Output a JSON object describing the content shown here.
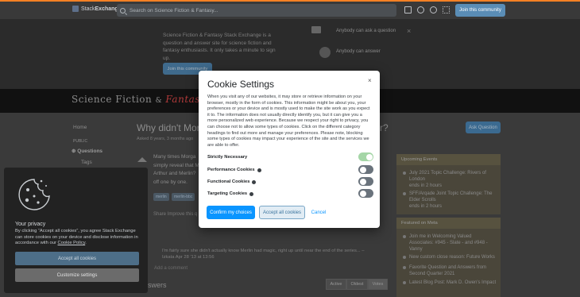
{
  "topbar": {
    "brand_prefix": "Stack",
    "brand_suffix": "Exchange",
    "search_placeholder": "Search on Science Fiction & Fantasy...",
    "join_label": "Join this community",
    "icons": [
      "inbox-icon",
      "achievements-icon",
      "help-icon",
      "site-switcher-icon"
    ]
  },
  "hero": {
    "description": "Science Fiction & Fantasy Stack Exchange is a question and answer site for science fiction and fantasy enthusiasts. It only takes a minute to sign up.",
    "join_label": "Join this community",
    "items": [
      "Anybody can ask a question",
      "Anybody can answer"
    ]
  },
  "banner": {
    "title_plain": "Science Fiction",
    "amp": "&",
    "title_accent": "Fantasy"
  },
  "left_nav": {
    "home": "Home",
    "public": "PUBLIC",
    "questions": "Questions",
    "tags": "Tags"
  },
  "question": {
    "title_start": "Why didn't Mor",
    "title_end": "r?",
    "meta": "Asked 8 years, 3 months ago",
    "body_lines": [
      "Many times Morga",
      "simply reveal that M",
      "Arthur and Merlin?",
      "off one by one."
    ],
    "tags": [
      "merlin",
      "merlin-bbc"
    ],
    "share": "Share  Improve this q",
    "comment_line1": "I'm fairly sure she didn't actually know Merlin had magic, right up until near the end of the series... –",
    "comment_line2": "Izkata  Apr 28 '13 at 13:56",
    "add_comment": "Add a comment",
    "answers_heading": "swers",
    "sort_options": [
      "Active",
      "Oldest",
      "Votes"
    ],
    "ask_button": "Ask Question"
  },
  "sidebar": {
    "upcoming_title": "Upcoming Events",
    "upcoming_items": [
      {
        "title": "July 2021 Topic Challenge: Rivers of London",
        "note": "ends in 2 hours"
      },
      {
        "title": "SFF/Arqade Joint Topic Challenge: The Elder Scrolls",
        "note": "ends in 2 hours"
      }
    ],
    "meta_title": "Featured on Meta",
    "meta_items": [
      "Join me in Welcoming Valued Associates: #945 - Slate - and #948 - Vanny",
      "New custom close reason: Future Works",
      "Favorite Question and Answers from Second Quarter 2021",
      "Latest Blog Post: Mark D. Owen's Impact"
    ]
  },
  "cookie_modal": {
    "title": "Cookie Settings",
    "close": "×",
    "text": "When you visit any of our websites, it may store or retrieve information on your browser, mostly in the form of cookies. This information might be about you, your preferences or your device and is mostly used to make the site work as you expect it to. The information does not usually directly identify you, but it can give you a more personalized web experience. Because we respect your right to privacy, you can choose not to allow some types of cookies. Click on the different category headings to find out more and manage your preferences. Please note, blocking some types of cookies may impact your experience of the site and the services we are able to offer.",
    "toggles": [
      {
        "label": "Strictly Necessary",
        "on": true
      },
      {
        "label": "Performance Cookies",
        "on": false
      },
      {
        "label": "Functional Cookies",
        "on": false
      },
      {
        "label": "Targeting Cookies",
        "on": false
      }
    ],
    "confirm_label": "Confirm my choices",
    "accept_label": "Accept all cookies",
    "cancel_label": "Cancel"
  },
  "privacy_panel": {
    "title": "Your privacy",
    "text": "By clicking “Accept all cookies”, you agree Stack Exchange can store cookies on your device and disclose information in accordance with our",
    "link": "Cookie Policy",
    "period": ".",
    "accept_label": "Accept all cookies",
    "customize_label": "Customize settings"
  }
}
